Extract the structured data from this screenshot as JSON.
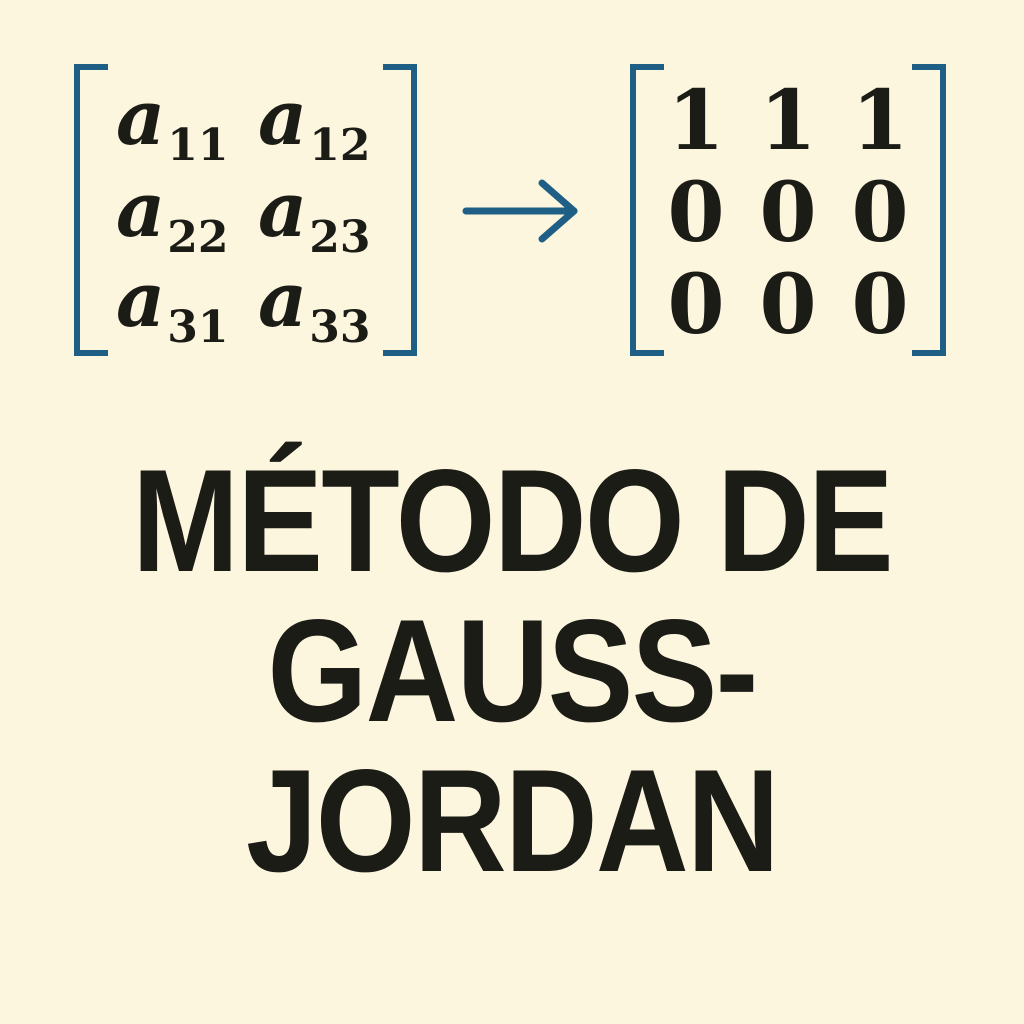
{
  "matrix_left": {
    "rows": [
      [
        {
          "base": "a",
          "sub": "11"
        },
        {
          "base": "a",
          "sub": "12"
        }
      ],
      [
        {
          "base": "a",
          "sub": "22"
        },
        {
          "base": "a",
          "sub": "23"
        }
      ],
      [
        {
          "base": "a",
          "sub": "31"
        },
        {
          "base": "a",
          "sub": "33"
        }
      ]
    ]
  },
  "matrix_right": {
    "rows": [
      [
        "1",
        "1",
        "1"
      ],
      [
        "0",
        "0",
        "0"
      ],
      [
        "0",
        "0",
        "0"
      ]
    ]
  },
  "title": {
    "lines": [
      "MÉTODO DE",
      "GAUSS-",
      "JORDAN"
    ]
  },
  "colors": {
    "background": "#fdf6df",
    "bracket": "#1f5f86",
    "arrow": "#1f5f86",
    "text": "#1c1c17"
  },
  "icons": {
    "arrow": "right-arrow-icon"
  }
}
